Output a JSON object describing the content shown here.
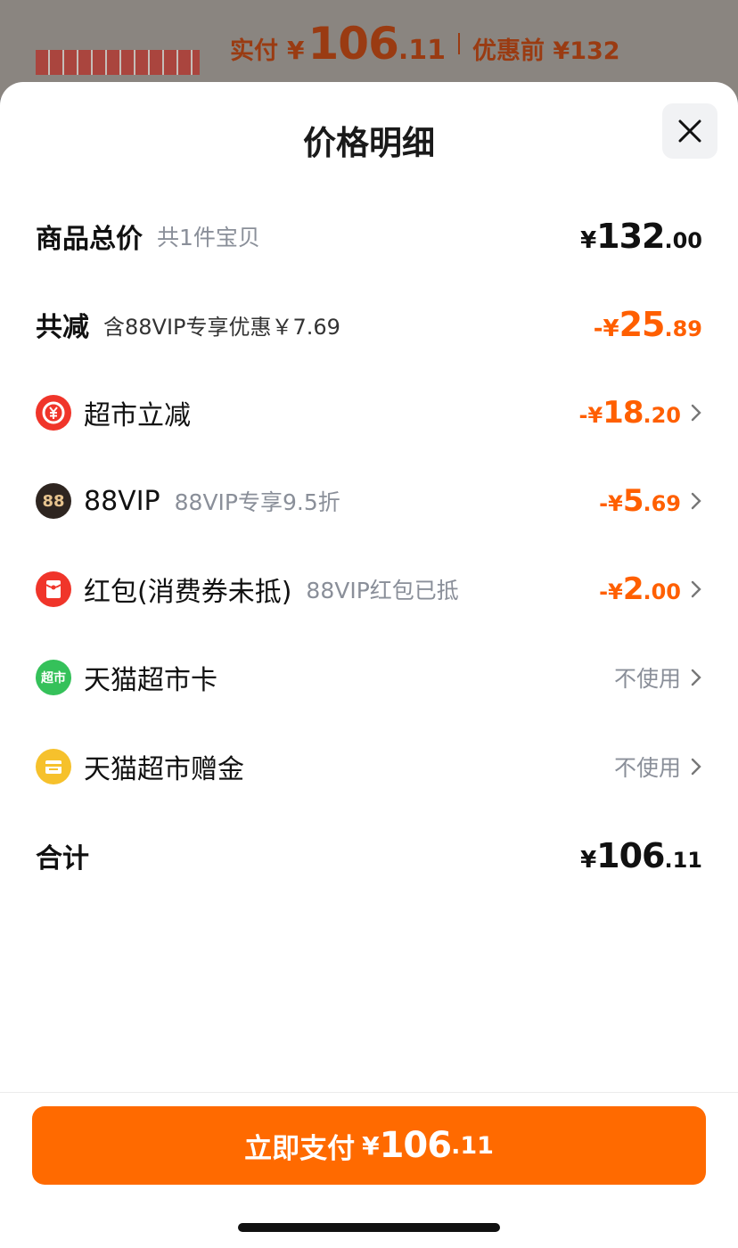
{
  "backdrop": {
    "paid_label": "实付",
    "currency": "¥",
    "paid_int": "106",
    "paid_dec": ".11",
    "original_label": "优惠前 ¥132"
  },
  "sheet": {
    "title": "价格明细",
    "close_icon": "close-icon"
  },
  "rows": {
    "total": {
      "label": "商品总价",
      "sub": "共1件宝贝",
      "yen": "¥",
      "int": "132",
      "dec": ".00"
    },
    "discount": {
      "label": "共减",
      "sub": "含88VIP专享优惠￥7.69",
      "yen": "-¥",
      "int": "25",
      "dec": ".89"
    },
    "supermarket_cut": {
      "label": "超市立减",
      "icon": "yen-discount-icon",
      "yen": "-¥",
      "int": "18",
      "dec": ".20"
    },
    "vip88": {
      "label": "88VIP",
      "sub": "88VIP专享9.5折",
      "icon": "88vip-icon",
      "icon_text": "88",
      "yen": "-¥",
      "int": "5",
      "dec": ".69"
    },
    "red_packet": {
      "label": "红包(消费券未抵)",
      "sub": "88VIP红包已抵",
      "icon": "red-packet-icon",
      "icon_text": "¥",
      "yen": "-¥",
      "int": "2",
      "dec": ".00"
    },
    "tmall_card": {
      "label": "天猫超市卡",
      "icon": "tmall-card-icon",
      "icon_text": "超市",
      "value": "不使用"
    },
    "tmall_gift": {
      "label": "天猫超市赠金",
      "icon": "gift-icon",
      "value": "不使用"
    },
    "sum": {
      "label": "合计",
      "yen": "¥",
      "int": "106",
      "dec": ".11"
    }
  },
  "pay_button": {
    "label": "立即支付",
    "yen": "¥",
    "int": "106",
    "dec": ".11"
  },
  "colors": {
    "accent": "#ff6a00",
    "discount": "#ff5f00"
  }
}
